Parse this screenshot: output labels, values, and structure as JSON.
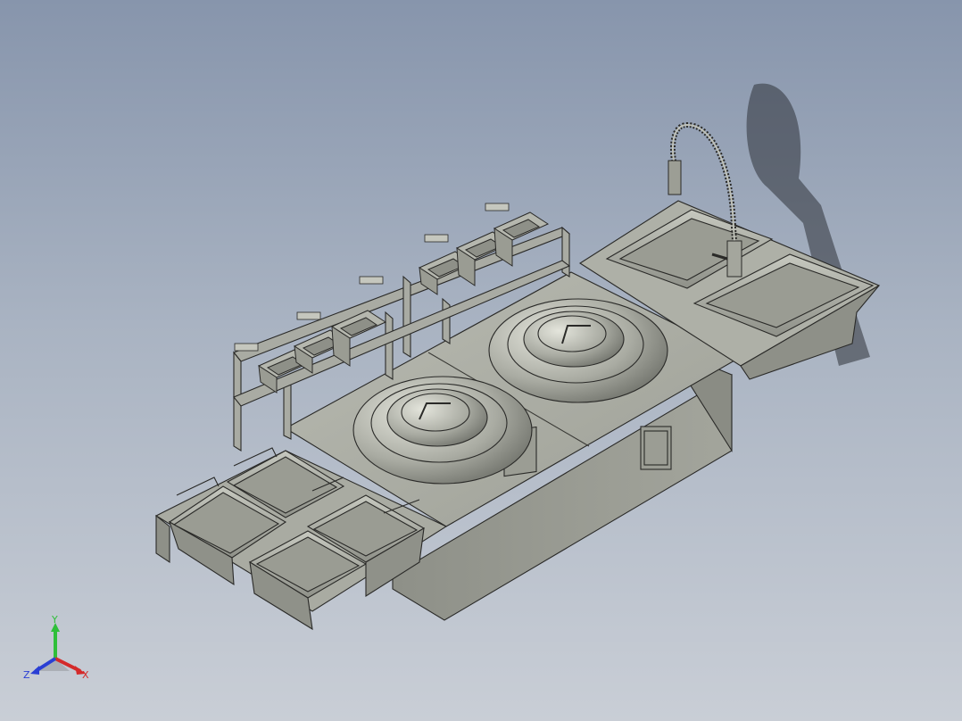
{
  "viewport": {
    "background_top": "#8795ac",
    "background_bottom": "#c9ced6",
    "model_fill": "#a7a9a1",
    "model_edge": "#2a2a28"
  },
  "triad": {
    "x_label": "X",
    "y_label": "Y",
    "z_label": "Z",
    "x_color": "#d42a2a",
    "y_color": "#2fbf3a",
    "z_color": "#2a3fd4"
  }
}
